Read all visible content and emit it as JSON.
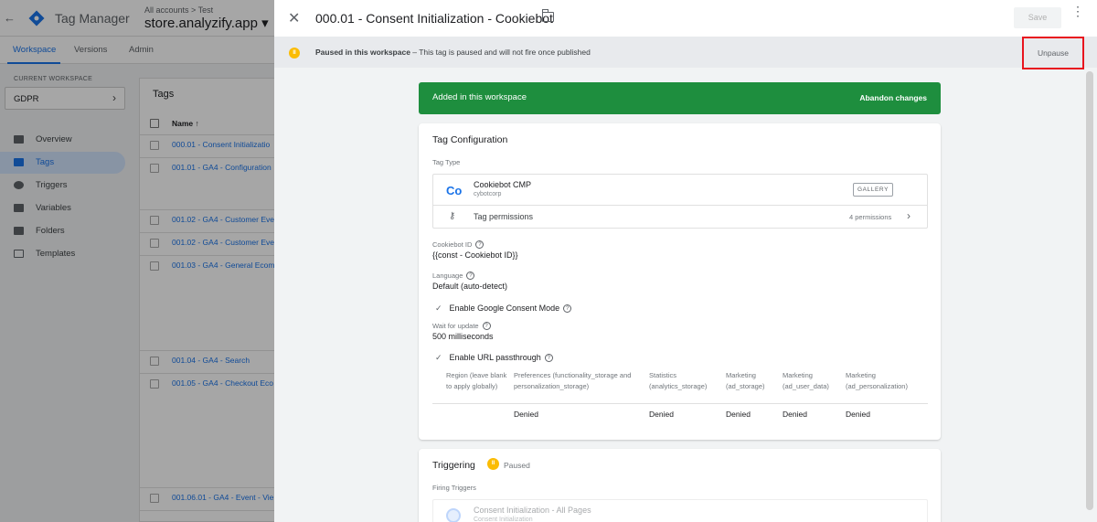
{
  "app": {
    "back_arrow": "←",
    "name": "Tag Manager",
    "account_path": "All accounts > Test",
    "container": "store.analyzify.app ▾"
  },
  "nav_tabs": [
    "Workspace",
    "Versions",
    "Admin"
  ],
  "workspace": {
    "label": "CURRENT WORKSPACE",
    "name": "GDPR"
  },
  "sidebar": {
    "items": [
      {
        "label": "Overview",
        "icon": "overview-icon"
      },
      {
        "label": "Tags",
        "icon": "tag-icon",
        "active": true
      },
      {
        "label": "Triggers",
        "icon": "trigger-icon"
      },
      {
        "label": "Variables",
        "icon": "variables-icon"
      },
      {
        "label": "Folders",
        "icon": "folder-icon"
      },
      {
        "label": "Templates",
        "icon": "template-icon"
      }
    ]
  },
  "tags_list": {
    "title": "Tags",
    "column_name": "Name ↑",
    "rows": [
      "000.01 - Consent Initializatio",
      "001.01 - GA4 - Configuration",
      "001.02 - GA4 - Customer Eve",
      "001.02 - GA4 - Customer Eve",
      "001.03 - GA4 - General Ecom",
      "001.04 - GA4 - Search",
      "001.05 - GA4 - Checkout Eco",
      "001.06.01 - GA4 - Event - Vie"
    ]
  },
  "sheet": {
    "title": "000.01 - Consent Initialization - Cookiebot",
    "save": "Save",
    "more": "⋮",
    "close": "✕"
  },
  "banner": {
    "bold": "Paused in this workspace",
    "text": " – This tag is paused and will not fire once published",
    "action": "Unpause"
  },
  "status_bar": {
    "left": "Added in this workspace",
    "right": "Abandon changes",
    "color": "#1e8e3e"
  },
  "tag_config": {
    "title": "Tag Configuration",
    "tag_type_label": "Tag Type",
    "tag_type_name": "Cookiebot CMP",
    "tag_type_vendor": "cybotcorp",
    "tag_type_logo": "Co",
    "gallery": "GALLERY",
    "permissions_label": "Tag permissions",
    "permissions_count": "4 permissions",
    "cookiebot_id_label": "Cookiebot ID",
    "cookiebot_id_value": "{{const - Cookiebot ID}}",
    "language_label": "Language",
    "language_value": "Default (auto-detect)",
    "consent_mode": "Enable Google Consent Mode",
    "wait_label": "Wait for update",
    "wait_value": "500  milliseconds",
    "url_passthrough": "Enable URL passthrough",
    "table": {
      "columns": [
        [
          "Region (leave blank",
          "to apply globally)"
        ],
        [
          "Preferences (functionality_storage and",
          "personalization_storage)"
        ],
        [
          "Statistics",
          "(analytics_storage)"
        ],
        [
          "Marketing",
          "(ad_storage)"
        ],
        [
          "Marketing",
          "(ad_user_data)"
        ],
        [
          "Marketing",
          "(ad_personalization)"
        ]
      ],
      "row": [
        "",
        "Denied",
        "Denied",
        "Denied",
        "Denied",
        "Denied"
      ]
    }
  },
  "triggering": {
    "title": "Triggering",
    "status": "Paused",
    "firing_label": "Firing Triggers",
    "trigger_name": "Consent Initialization - All Pages",
    "trigger_type": "Consent Initialization"
  }
}
